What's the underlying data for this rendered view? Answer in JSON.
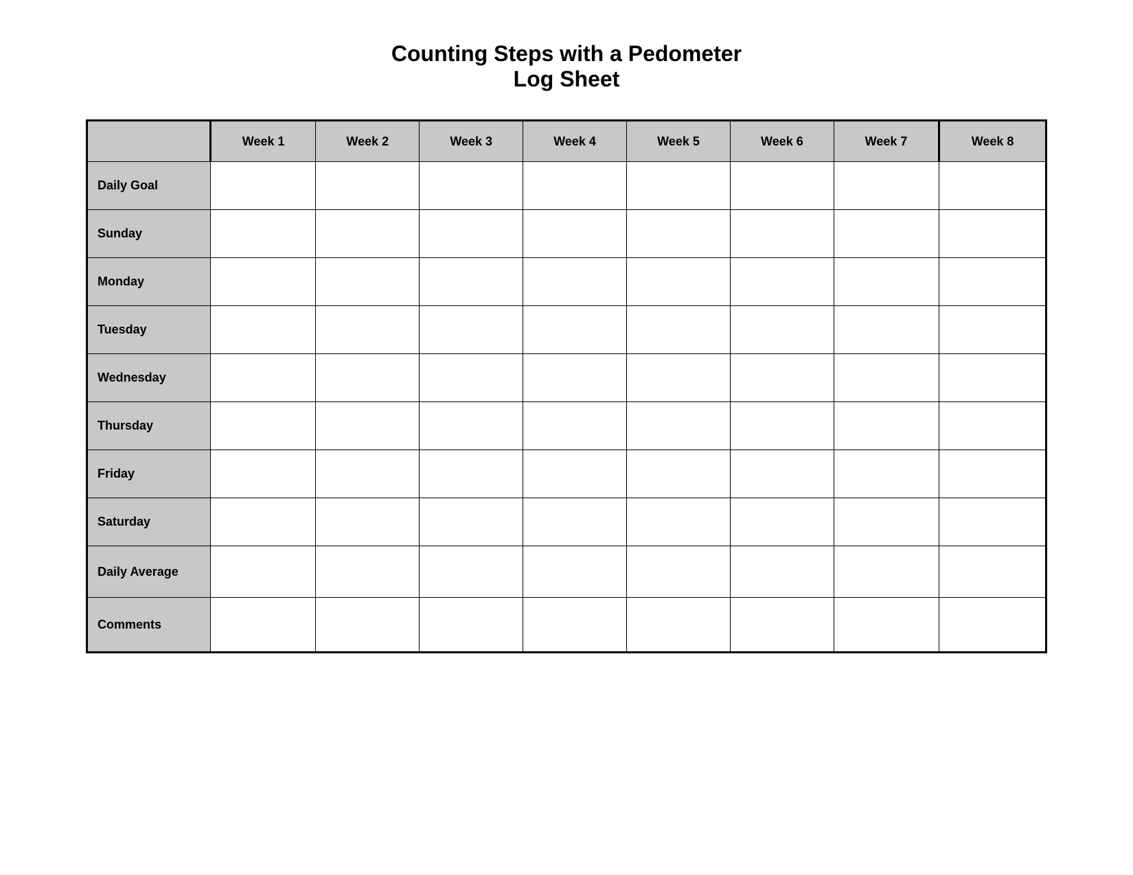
{
  "title": {
    "line1": "Counting Steps with a Pedometer",
    "line2": "Log Sheet"
  },
  "table": {
    "header": {
      "empty_label": "",
      "weeks": [
        "Week 1",
        "Week 2",
        "Week 3",
        "Week 4",
        "Week 5",
        "Week 6",
        "Week 7",
        "Week 8"
      ]
    },
    "rows": [
      {
        "label": "Daily Goal"
      },
      {
        "label": "Sunday"
      },
      {
        "label": "Monday"
      },
      {
        "label": "Tuesday"
      },
      {
        "label": "Wednesday"
      },
      {
        "label": "Thursday"
      },
      {
        "label": "Friday"
      },
      {
        "label": "Saturday"
      },
      {
        "label": "Daily Average",
        "class": "summary-row"
      },
      {
        "label": "Comments",
        "class": "comments-row"
      }
    ]
  }
}
